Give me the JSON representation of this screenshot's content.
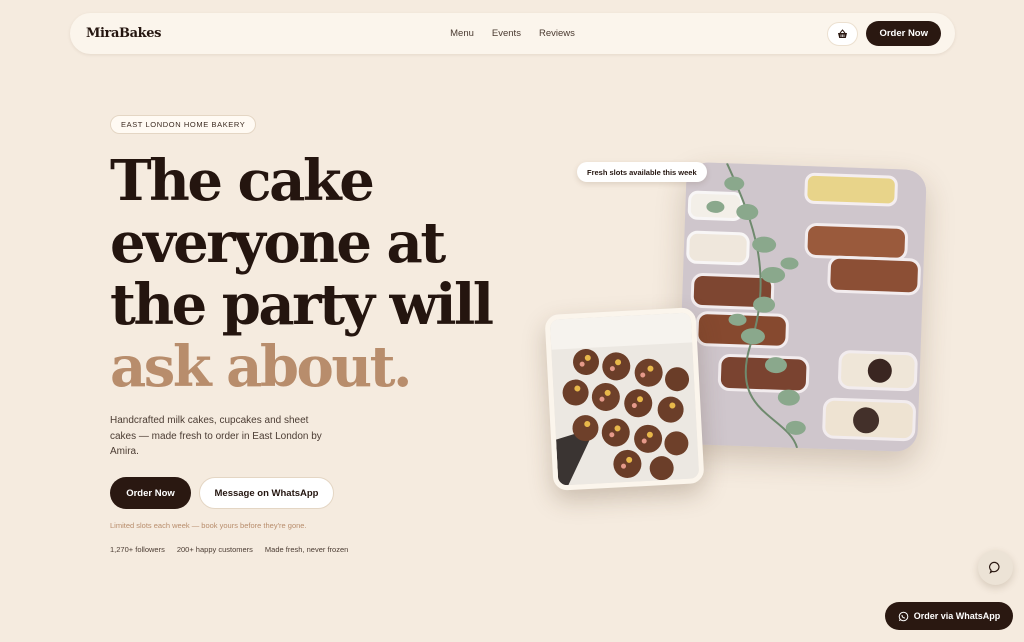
{
  "nav": {
    "brand": "MiraBakes",
    "links": [
      "Menu",
      "Events",
      "Reviews"
    ],
    "cart_icon": "basket-icon",
    "order_label": "Order Now"
  },
  "hero": {
    "badge": "EAST LONDON HOME BAKERY",
    "headline_lines": [
      "The cake",
      "everyone at",
      "the party will"
    ],
    "headline_accent": "ask about.",
    "lead": "Handcrafted milk cakes, cupcakes and sheet cakes — made fresh to order in East London by Amira.",
    "primary_cta": "Order Now",
    "secondary_cta": "Message on WhatsApp",
    "limited_note": "Limited slots each week — book yours before they're gone.",
    "stats": [
      "1,270+ followers",
      "200+ happy customers",
      "Made fresh, never frozen"
    ]
  },
  "gallery": {
    "tag": "Fresh slots available this week"
  },
  "floating": {
    "chat_icon": "chat-bubble-icon",
    "whatsapp_icon": "whatsapp-icon",
    "whatsapp_label": "Order via WhatsApp"
  },
  "colors": {
    "background": "#f5ebdf",
    "dark": "#2a1811",
    "accent": "#b88d6c"
  }
}
